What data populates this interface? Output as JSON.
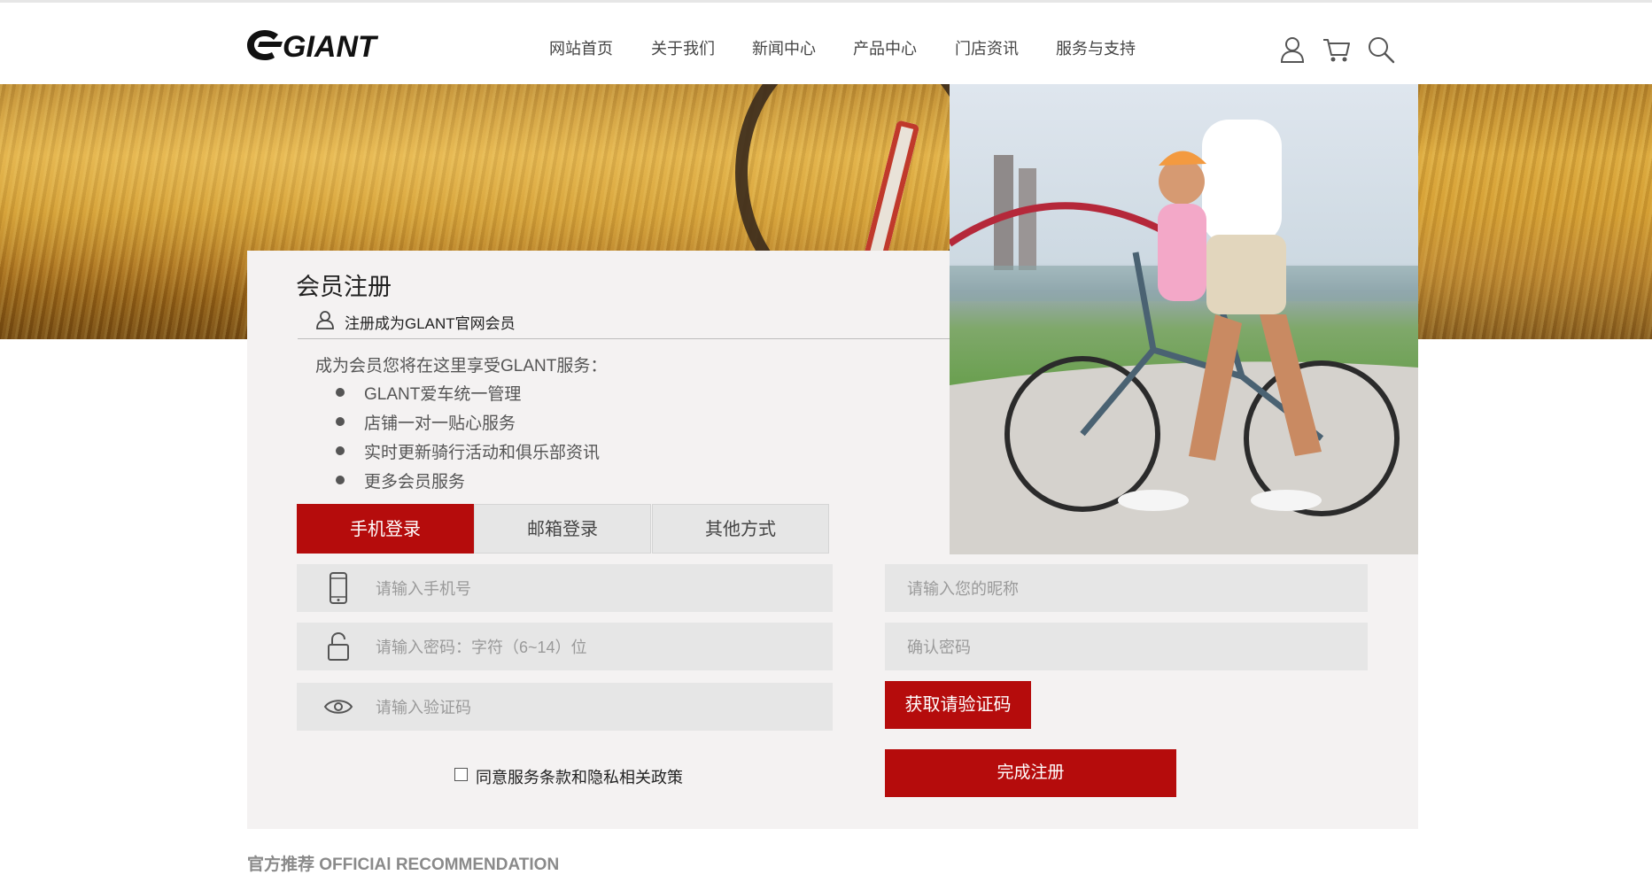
{
  "header": {
    "logo_text": "GIANT",
    "nav": [
      {
        "label": "网站首页"
      },
      {
        "label": "关于我们"
      },
      {
        "label": "新闻中心"
      },
      {
        "label": "产品中心"
      },
      {
        "label": "门店资讯"
      },
      {
        "label": "服务与支持"
      }
    ],
    "icons": [
      "user-icon",
      "cart-icon",
      "search-icon"
    ]
  },
  "register": {
    "title": "会员注册",
    "subtitle": "注册成为GLANT官网会员",
    "intro": "成为会员您将在这里享受GLANT服务：",
    "benefits": [
      "GLANT爱车统一管理",
      "店铺一对一贴心服务",
      "实时更新骑行活动和俱乐部资讯",
      "更多会员服务"
    ]
  },
  "tabs": [
    {
      "label": "手机登录",
      "active": true
    },
    {
      "label": "邮箱登录",
      "active": false
    },
    {
      "label": "其他方式",
      "active": false
    }
  ],
  "form": {
    "phone_placeholder": "请输入手机号",
    "password_placeholder": "请输入密码：字符（6~14）位",
    "code_placeholder": "请输入验证码",
    "nickname_placeholder": "请输入您的昵称",
    "confirm_placeholder": "确认密码",
    "get_code_label": "获取请验证码",
    "submit_label": "完成注册",
    "agree_label": "同意服务条款和隐私相关政策",
    "agree_checked": false
  },
  "recommendation_title": "官方推荐 OFFICIAl RECOMMENDATION",
  "colors": {
    "accent": "#b50c0c",
    "field_bg": "#e6e6e6",
    "card_bg": "#f4f2f2"
  }
}
